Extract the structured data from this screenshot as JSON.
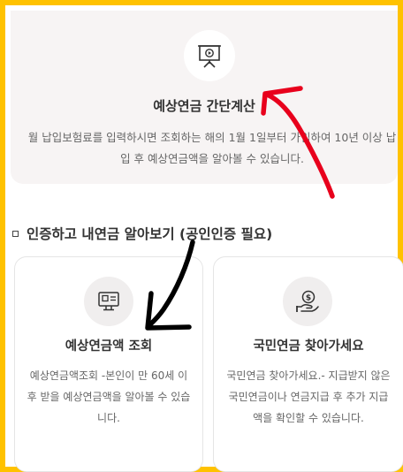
{
  "top_card": {
    "icon": "presentation-board-icon",
    "title": "예상연금 간단계산",
    "description": "월 납입보험료를 입력하시면 조회하는 해의 1월 1일부터 가입하여 10년 이상 납입 후 예상연금액을 알아볼 수 있습니다."
  },
  "section": {
    "title": "인증하고 내연금 알아보기 (공인인증 필요)"
  },
  "cards": [
    {
      "icon": "monitor-chart-icon",
      "title": "예상연금액 조회",
      "description": "예상연금액조회 -본인이 만 60세 이후 받을 예상연금액을 알아볼 수 있습니다."
    },
    {
      "icon": "hand-coin-icon",
      "title": "국민연금 찾아가세요",
      "description": "국민연금 찾아가세요.- 지급받지 않은 국민연금이나 연금지급 후 추가 지급액을 확인할 수 있습니다."
    }
  ],
  "colors": {
    "frame_border": "#FFC200",
    "top_card_bg": "#f7f4f4",
    "annotation_red": "#E8001C",
    "annotation_black": "#000000"
  }
}
